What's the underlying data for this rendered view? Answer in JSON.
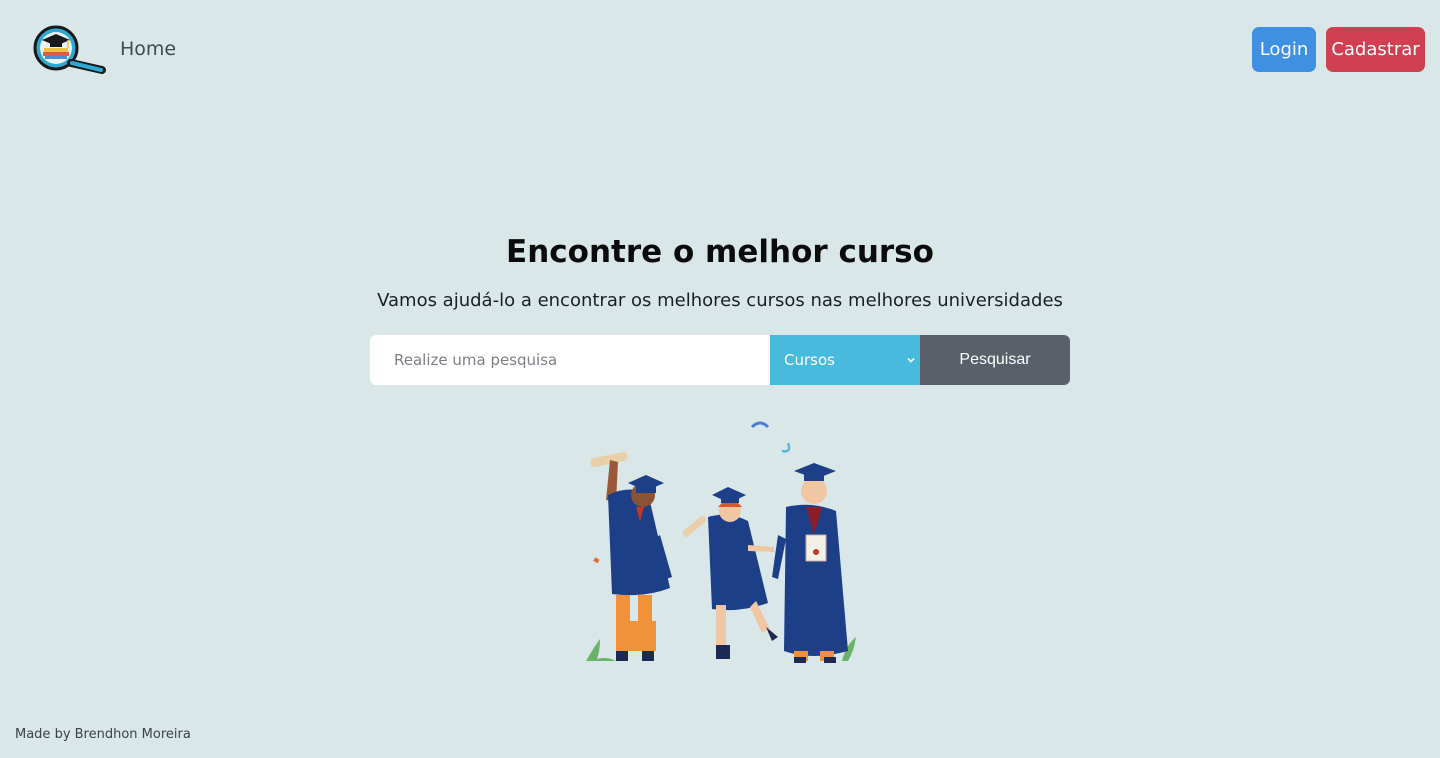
{
  "nav": {
    "logo_icon": "graduation-magnifier-logo-icon",
    "home_label": "Home",
    "login_label": "Login",
    "signup_label": "Cadastrar"
  },
  "hero": {
    "title": "Encontre o melhor curso",
    "subtitle": "Vamos ajudá-lo a encontrar os melhores cursos nas melhores universidades"
  },
  "search": {
    "placeholder": "Realize uma pesquisa",
    "value": "",
    "category_selected": "Cursos",
    "button_label": "Pesquisar"
  },
  "illustration": {
    "icon": "graduates-celebrating-illustration-icon"
  },
  "footer": {
    "credit": "Made by Brendhon Moreira"
  },
  "colors": {
    "background": "#d9e7e9",
    "login_button": "#3f8fe3",
    "signup_button": "#d03f52",
    "select_background": "#47bade",
    "search_button": "#596069",
    "gown_blue": "#1c3f87"
  }
}
